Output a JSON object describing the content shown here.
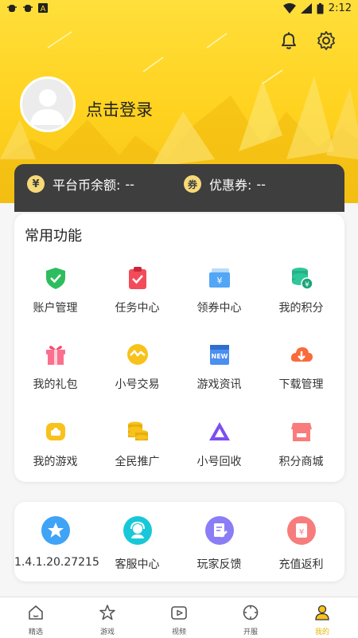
{
  "status_bar": {
    "time": "2:12"
  },
  "profile": {
    "login_text": "点击登录"
  },
  "wallet": {
    "balance_label": "平台币余额:",
    "balance_value": "--",
    "coupon_label": "优惠券:",
    "coupon_value": "--",
    "coin_glyph": "¥",
    "coupon_glyph": "券"
  },
  "common_functions": {
    "title": "常用功能",
    "items": [
      {
        "label": "账户管理",
        "icon": "shield-check-icon",
        "color": "#2dbd5e"
      },
      {
        "label": "任务中心",
        "icon": "clipboard-check-icon",
        "color": "#f34b5a"
      },
      {
        "label": "领券中心",
        "icon": "ticket-icon",
        "color": "#52a6f5"
      },
      {
        "label": "我的积分",
        "icon": "coins-points-icon",
        "color": "#2ec79a"
      },
      {
        "label": "我的礼包",
        "icon": "gift-icon",
        "color": "#fb6f8e"
      },
      {
        "label": "小号交易",
        "icon": "exchange-icon",
        "color": "#f8c21c"
      },
      {
        "label": "游戏资讯",
        "icon": "news-icon",
        "color": "#4b8ff0"
      },
      {
        "label": "下载管理",
        "icon": "cloud-download-icon",
        "color": "#f96b3a"
      },
      {
        "label": "我的游戏",
        "icon": "gamepad-icon",
        "color": "#f8c21c"
      },
      {
        "label": "全民推广",
        "icon": "coin-stack-icon",
        "color": "#f8c21c"
      },
      {
        "label": "小号回收",
        "icon": "recycle-triangle-icon",
        "color": "#7b4ff0"
      },
      {
        "label": "积分商城",
        "icon": "shop-icon",
        "color": "#f97c7c"
      }
    ]
  },
  "services": {
    "items": [
      {
        "label": "1.4.1.20.27215",
        "icon": "star-icon",
        "color": "#3fa3f6"
      },
      {
        "label": "客服中心",
        "icon": "customer-service-icon",
        "color": "#18c8d8"
      },
      {
        "label": "玩家反馈",
        "icon": "feedback-icon",
        "color": "#8a7df6"
      },
      {
        "label": "充值返利",
        "icon": "recharge-icon",
        "color": "#f77d7d"
      }
    ]
  },
  "tabbar": {
    "items": [
      {
        "label": "精选",
        "icon": "home-icon"
      },
      {
        "label": "游戏",
        "icon": "star-outline-icon"
      },
      {
        "label": "视频",
        "icon": "video-icon"
      },
      {
        "label": "开服",
        "icon": "compass-icon"
      },
      {
        "label": "我的",
        "icon": "user-icon"
      }
    ],
    "active_color": "#e6b800"
  }
}
